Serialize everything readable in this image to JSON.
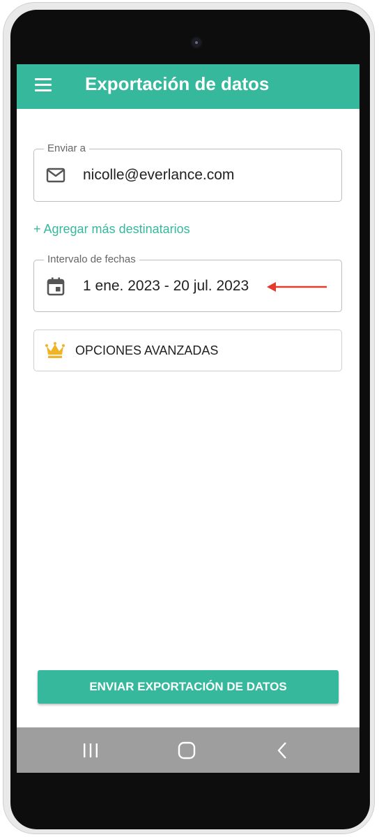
{
  "appbar": {
    "title": "Exportación de datos",
    "menu_icon": "menu-icon",
    "color": "#35b89c"
  },
  "send_to": {
    "label": "Enviar a",
    "value": "nicolle@everlance.com",
    "icon": "mail-icon"
  },
  "add_recipients": {
    "label": "+ Agregar más destinatarios"
  },
  "date_range": {
    "label": "Intervalo de fechas",
    "value": "1 ene. 2023 - 20 jul. 2023",
    "icon": "calendar-icon",
    "annotation_arrow_color": "#e53b2c"
  },
  "advanced_options": {
    "label": "OPCIONES AVANZADAS",
    "icon": "crown-icon",
    "icon_color": "#f0b429"
  },
  "submit": {
    "label": "ENVIAR EXPORTACIÓN DE DATOS"
  },
  "system_nav": {
    "recents_icon": "recents-icon",
    "home_icon": "home-icon",
    "back_icon": "back-icon"
  }
}
